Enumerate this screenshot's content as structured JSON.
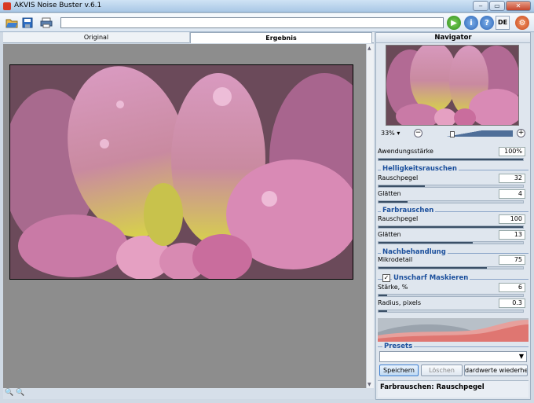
{
  "window": {
    "title": "AKVIS Noise Buster v.6.1"
  },
  "toolbar": {
    "path_value": "",
    "lang_label": "DE"
  },
  "tabs": [
    {
      "label": "Original"
    },
    {
      "label": "Ergebnis"
    }
  ],
  "navigator": {
    "title": "Navigator",
    "zoom": "33%"
  },
  "params": {
    "strength": {
      "label": "Awendungsstärke",
      "value": "100%",
      "level": 1.0
    },
    "brightness_noise": {
      "header": "Helligkeitsrauschen",
      "noise_level": {
        "label": "Rauschpegel",
        "value": "32",
        "level": 0.32
      },
      "smooth": {
        "label": "Glätten",
        "value": "4",
        "level": 0.2
      }
    },
    "color_noise": {
      "header": "Farbrauschen",
      "noise_level": {
        "label": "Rauschpegel",
        "value": "100",
        "level": 1.0
      },
      "smooth": {
        "label": "Glätten",
        "value": "13",
        "level": 0.65
      }
    },
    "post": {
      "header": "Nachbehandlung",
      "microdetail": {
        "label": "Mikrodetail",
        "value": "75",
        "level": 0.75
      }
    },
    "unsharp": {
      "header": "Unscharf Maskieren",
      "checkbox": "✓",
      "amount": {
        "label": "Stärke, %",
        "value": "6",
        "level": 0.06
      },
      "radius": {
        "label": "Radius, pixels",
        "value": "0.3",
        "level": 0.06
      }
    }
  },
  "presets": {
    "label": "Presets",
    "selected": "",
    "save": "Speichern",
    "delete": "Löschen",
    "restore": "dardwerte wiederherst"
  },
  "hint": {
    "text": "Farbrauschen: Rauschpegel"
  }
}
